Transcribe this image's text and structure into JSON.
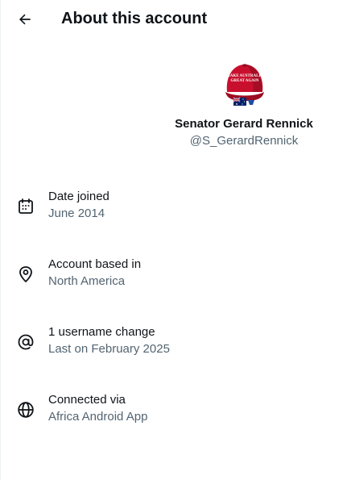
{
  "header": {
    "title": "About this account",
    "back_icon": "arrow-left-icon"
  },
  "profile": {
    "display_name": "Senator Gerard Rennick",
    "handle": "@S_GerardRennick",
    "avatar_description_icon": "red-cap-avatar",
    "cap_text_line1": "MAKE AUSTRALIA",
    "cap_text_line2": "GREAT AGAIN"
  },
  "details": [
    {
      "icon": "calendar-icon",
      "label": "Date joined",
      "value": "June 2014"
    },
    {
      "icon": "location-pin-icon",
      "label": "Account based in",
      "value": "North America"
    },
    {
      "icon": "at-sign-icon",
      "label": "1 username change",
      "value": "Last on February 2025"
    },
    {
      "icon": "globe-icon",
      "label": "Connected via",
      "value": "Africa Android App"
    }
  ],
  "colors": {
    "primary_text": "#0f1419",
    "secondary_text": "#536471",
    "cap_red": "#c8102e",
    "border": "#eff3f4"
  }
}
